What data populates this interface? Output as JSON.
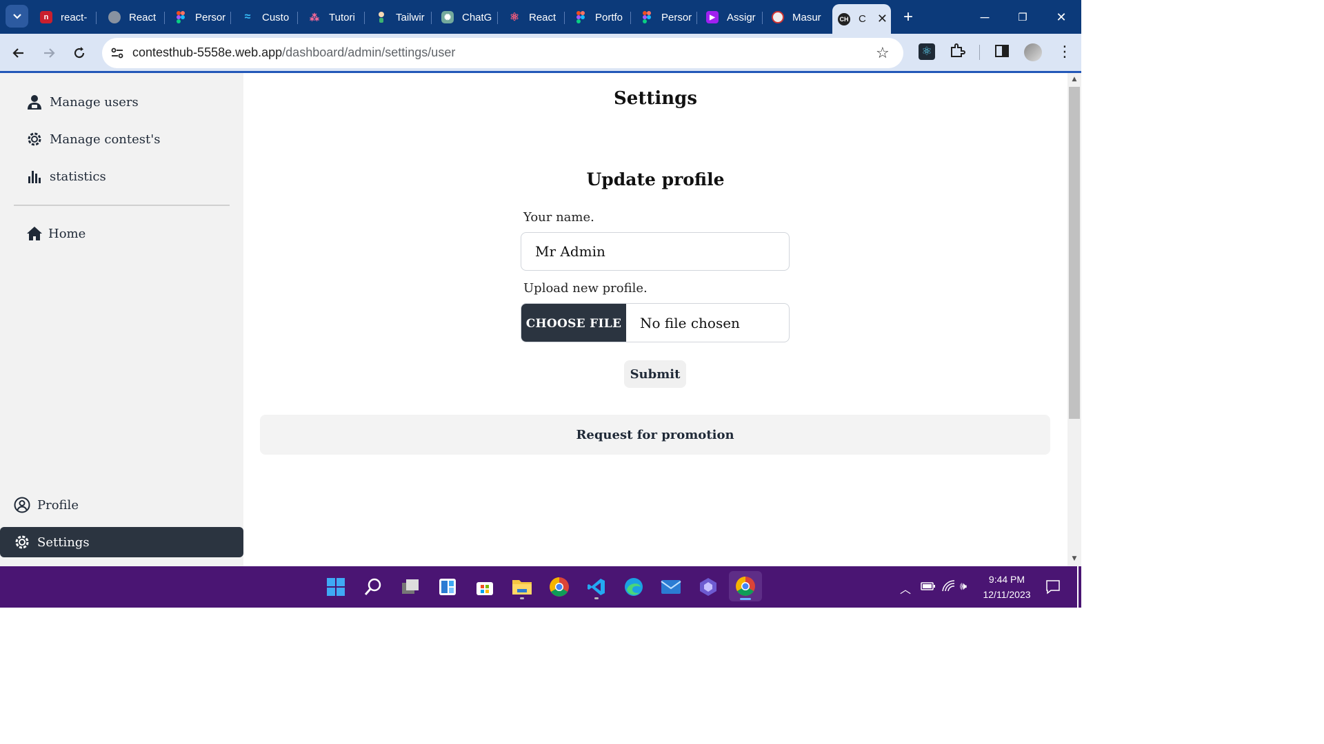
{
  "browser": {
    "tabs": [
      {
        "title": "react-",
        "favicon": "react-router-icon",
        "fav_text": "",
        "fav_bg": "#ca1f2e"
      },
      {
        "title": "React",
        "favicon": "globe-icon",
        "fav_text": "",
        "fav_bg": "#6b7a8f"
      },
      {
        "title": "Persor",
        "favicon": "figma-icon",
        "fav_text": "",
        "fav_bg": "#f24e1e"
      },
      {
        "title": "Custo",
        "favicon": "tailwind-icon",
        "fav_text": "~",
        "fav_bg": "#0c3a7a"
      },
      {
        "title": "Tutori",
        "favicon": "tutorial-icon",
        "fav_text": "",
        "fav_bg": "#0c3a7a"
      },
      {
        "title": "Tailwir",
        "favicon": "tailwind-elements-icon",
        "fav_text": "",
        "fav_bg": "#0c3a7a"
      },
      {
        "title": "ChatG",
        "favicon": "chatgpt-icon",
        "fav_text": "",
        "fav_bg": "#74aa9c"
      },
      {
        "title": "React",
        "favicon": "react-icon",
        "fav_text": "",
        "fav_bg": "#0c3a7a"
      },
      {
        "title": "Portfo",
        "favicon": "figma-icon",
        "fav_text": "",
        "fav_bg": "#f24e1e"
      },
      {
        "title": "Persor",
        "favicon": "figma-icon",
        "fav_text": "",
        "fav_bg": "#f24e1e"
      },
      {
        "title": "Assigr",
        "favicon": "video-icon",
        "fav_text": "",
        "fav_bg": "#a020f0"
      },
      {
        "title": "Masur",
        "favicon": "avatar-icon",
        "fav_text": "",
        "fav_bg": "#f4f4f4"
      },
      {
        "title": "C",
        "favicon": "contesthub-icon",
        "fav_text": "CH",
        "fav_bg": "#222222",
        "active": true
      }
    ],
    "url_host": "contesthub-5558e.web.app",
    "url_path": "/dashboard/admin/settings/user"
  },
  "sidebar": {
    "items": [
      {
        "label": "Manage users",
        "icon": "user-shield-icon"
      },
      {
        "label": "Manage contest's",
        "icon": "gear-icon"
      },
      {
        "label": "statistics",
        "icon": "bar-chart-icon"
      },
      {
        "label": "Home",
        "icon": "home-icon"
      }
    ],
    "bottom": [
      {
        "label": "Profile",
        "icon": "user-circle-icon"
      },
      {
        "label": "Settings",
        "icon": "gear-icon",
        "active": true
      }
    ]
  },
  "main": {
    "title": "Settings",
    "form": {
      "title": "Update profile",
      "name_label": "Your name.",
      "name_value": "Mr Admin",
      "upload_label": "Upload new profile.",
      "choose_file": "CHOOSE FILE",
      "no_file": "No file chosen",
      "submit": "Submit"
    },
    "promotion": "Request for promotion"
  },
  "taskbar": {
    "time": "9:44 PM",
    "date": "12/11/2023",
    "apps": [
      "windows-start-icon",
      "search-icon",
      "task-view-icon",
      "widgets-icon",
      "store-icon",
      "file-explorer-icon",
      "chrome-icon",
      "vscode-icon",
      "edge-icon",
      "mail-icon",
      "app-icon",
      "chrome-active-icon"
    ]
  },
  "colors": {
    "browser_frame": "#0c3a7a",
    "toolbar": "#dbe5f5",
    "sidebar_bg": "#f2f2f2",
    "dark_accent": "#2b3440",
    "taskbar": "#4a1573"
  }
}
